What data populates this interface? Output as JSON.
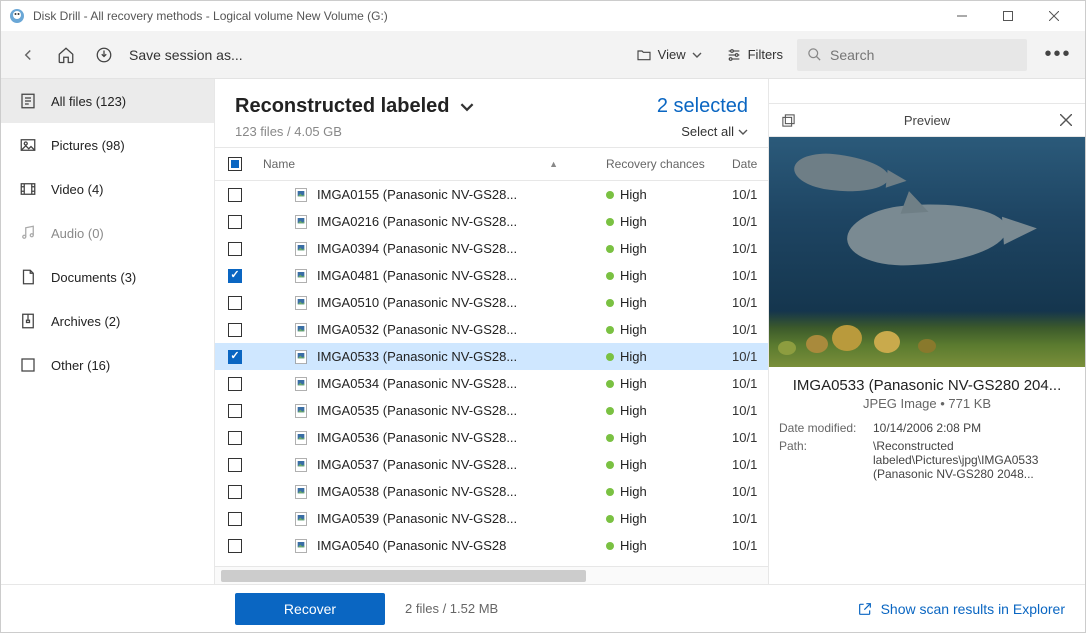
{
  "window": {
    "title": "Disk Drill - All recovery methods - Logical volume New Volume (G:)"
  },
  "toolbar": {
    "save_session": "Save session as...",
    "view_label": "View",
    "filters_label": "Filters",
    "search_placeholder": "Search"
  },
  "sidebar": {
    "items": [
      {
        "label": "All files (123)",
        "active": true,
        "muted": false,
        "icon": "all-files"
      },
      {
        "label": "Pictures (98)",
        "active": false,
        "muted": false,
        "icon": "pictures"
      },
      {
        "label": "Video (4)",
        "active": false,
        "muted": false,
        "icon": "video"
      },
      {
        "label": "Audio (0)",
        "active": false,
        "muted": true,
        "icon": "audio"
      },
      {
        "label": "Documents (3)",
        "active": false,
        "muted": false,
        "icon": "documents"
      },
      {
        "label": "Archives (2)",
        "active": false,
        "muted": false,
        "icon": "archives"
      },
      {
        "label": "Other (16)",
        "active": false,
        "muted": false,
        "icon": "other"
      }
    ]
  },
  "header": {
    "crumb_title": "Reconstructed labeled",
    "crumb_sub": "123 files / 4.05 GB",
    "selected_label": "2 selected",
    "select_all": "Select all"
  },
  "columns": {
    "name": "Name",
    "recovery": "Recovery chances",
    "date": "Date"
  },
  "rows": [
    {
      "name": "IMGA0155 (Panasonic NV-GS28...",
      "rec": "High",
      "date": "10/1",
      "checked": false,
      "selected": false
    },
    {
      "name": "IMGA0216 (Panasonic NV-GS28...",
      "rec": "High",
      "date": "10/1",
      "checked": false,
      "selected": false
    },
    {
      "name": "IMGA0394 (Panasonic NV-GS28...",
      "rec": "High",
      "date": "10/1",
      "checked": false,
      "selected": false
    },
    {
      "name": "IMGA0481 (Panasonic NV-GS28...",
      "rec": "High",
      "date": "10/1",
      "checked": true,
      "selected": false
    },
    {
      "name": "IMGA0510 (Panasonic NV-GS28...",
      "rec": "High",
      "date": "10/1",
      "checked": false,
      "selected": false
    },
    {
      "name": "IMGA0532 (Panasonic NV-GS28...",
      "rec": "High",
      "date": "10/1",
      "checked": false,
      "selected": false
    },
    {
      "name": "IMGA0533 (Panasonic NV-GS28...",
      "rec": "High",
      "date": "10/1",
      "checked": true,
      "selected": true
    },
    {
      "name": "IMGA0534 (Panasonic NV-GS28...",
      "rec": "High",
      "date": "10/1",
      "checked": false,
      "selected": false
    },
    {
      "name": "IMGA0535 (Panasonic NV-GS28...",
      "rec": "High",
      "date": "10/1",
      "checked": false,
      "selected": false
    },
    {
      "name": "IMGA0536 (Panasonic NV-GS28...",
      "rec": "High",
      "date": "10/1",
      "checked": false,
      "selected": false
    },
    {
      "name": "IMGA0537 (Panasonic NV-GS28...",
      "rec": "High",
      "date": "10/1",
      "checked": false,
      "selected": false
    },
    {
      "name": "IMGA0538 (Panasonic NV-GS28...",
      "rec": "High",
      "date": "10/1",
      "checked": false,
      "selected": false
    },
    {
      "name": "IMGA0539 (Panasonic NV-GS28...",
      "rec": "High",
      "date": "10/1",
      "checked": false,
      "selected": false
    },
    {
      "name": "IMGA0540 (Panasonic NV-GS28",
      "rec": "High",
      "date": "10/1",
      "checked": false,
      "selected": false
    }
  ],
  "preview": {
    "title": "Preview",
    "filename": "IMGA0533 (Panasonic NV-GS280 204...",
    "subtitle": "JPEG Image • 771 KB",
    "meta": {
      "date_modified_k": "Date modified:",
      "date_modified_v": "10/14/2006 2:08 PM",
      "path_k": "Path:",
      "path_v": "\\Reconstructed labeled\\Pictures\\jpg\\IMGA0533 (Panasonic NV-GS280 2048..."
    }
  },
  "footer": {
    "recover_label": "Recover",
    "info": "2 files / 1.52 MB",
    "explorer_link": "Show scan results in Explorer"
  }
}
